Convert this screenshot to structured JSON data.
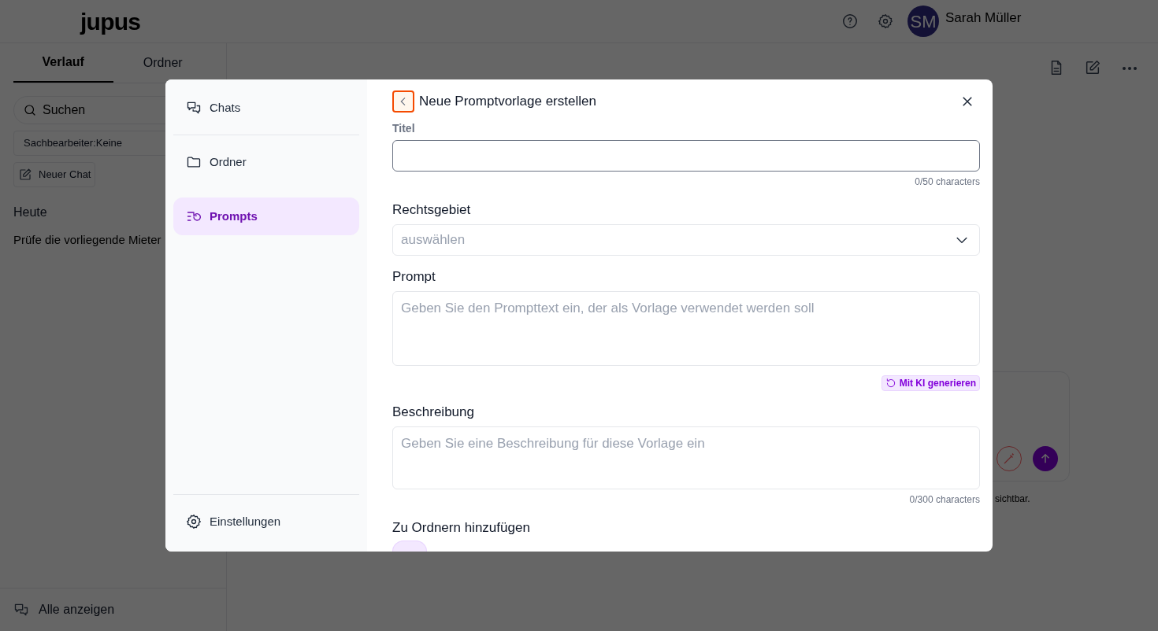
{
  "app": {
    "logo": "jupus",
    "user": {
      "initials": "SM",
      "name": "Sarah Müller"
    }
  },
  "sidebar": {
    "tabs": [
      {
        "label": "Verlauf",
        "selected": true
      },
      {
        "label": "Ordner",
        "selected": false
      }
    ],
    "search": {
      "placeholder": "Suchen"
    },
    "filter": {
      "label": "Sachbearbeiter:",
      "value": "Keine"
    },
    "new_chat": "Neuer Chat",
    "groups": [
      {
        "heading": "Heute",
        "items": [
          "Prüfe die vorliegende Mieter"
        ]
      }
    ],
    "show_all": "Alle anzeigen"
  },
  "chat": {
    "footer_note": "sichtbar."
  },
  "modal": {
    "nav": [
      {
        "label": "Chats",
        "selected": false
      },
      {
        "label": "Ordner",
        "selected": false
      },
      {
        "label": "Prompts",
        "selected": true
      }
    ],
    "settings": "Einstellungen",
    "title": "Neue Promptvorlage erstellen",
    "fields": [
      {
        "kind": "text",
        "label": "Titel",
        "focused": true,
        "counter": "0/50 characters"
      },
      {
        "kind": "select",
        "label": "Rechtsgebiet",
        "focused": false,
        "placeholder": "auswählen"
      },
      {
        "kind": "textarea",
        "label": "Prompt",
        "focused": false,
        "placeholder": "Geben Sie den Prompttext ein, der als Vorlage verwendet werden soll",
        "action": "Mit KI generieren"
      },
      {
        "kind": "textarea",
        "label": "Beschreibung",
        "focused": false,
        "placeholder": "Geben Sie eine Beschreibung für diese Vorlage ein",
        "counter": "0/300 characters"
      },
      {
        "kind": "chips",
        "label": "Zu Ordnern hinzufügen"
      }
    ]
  }
}
